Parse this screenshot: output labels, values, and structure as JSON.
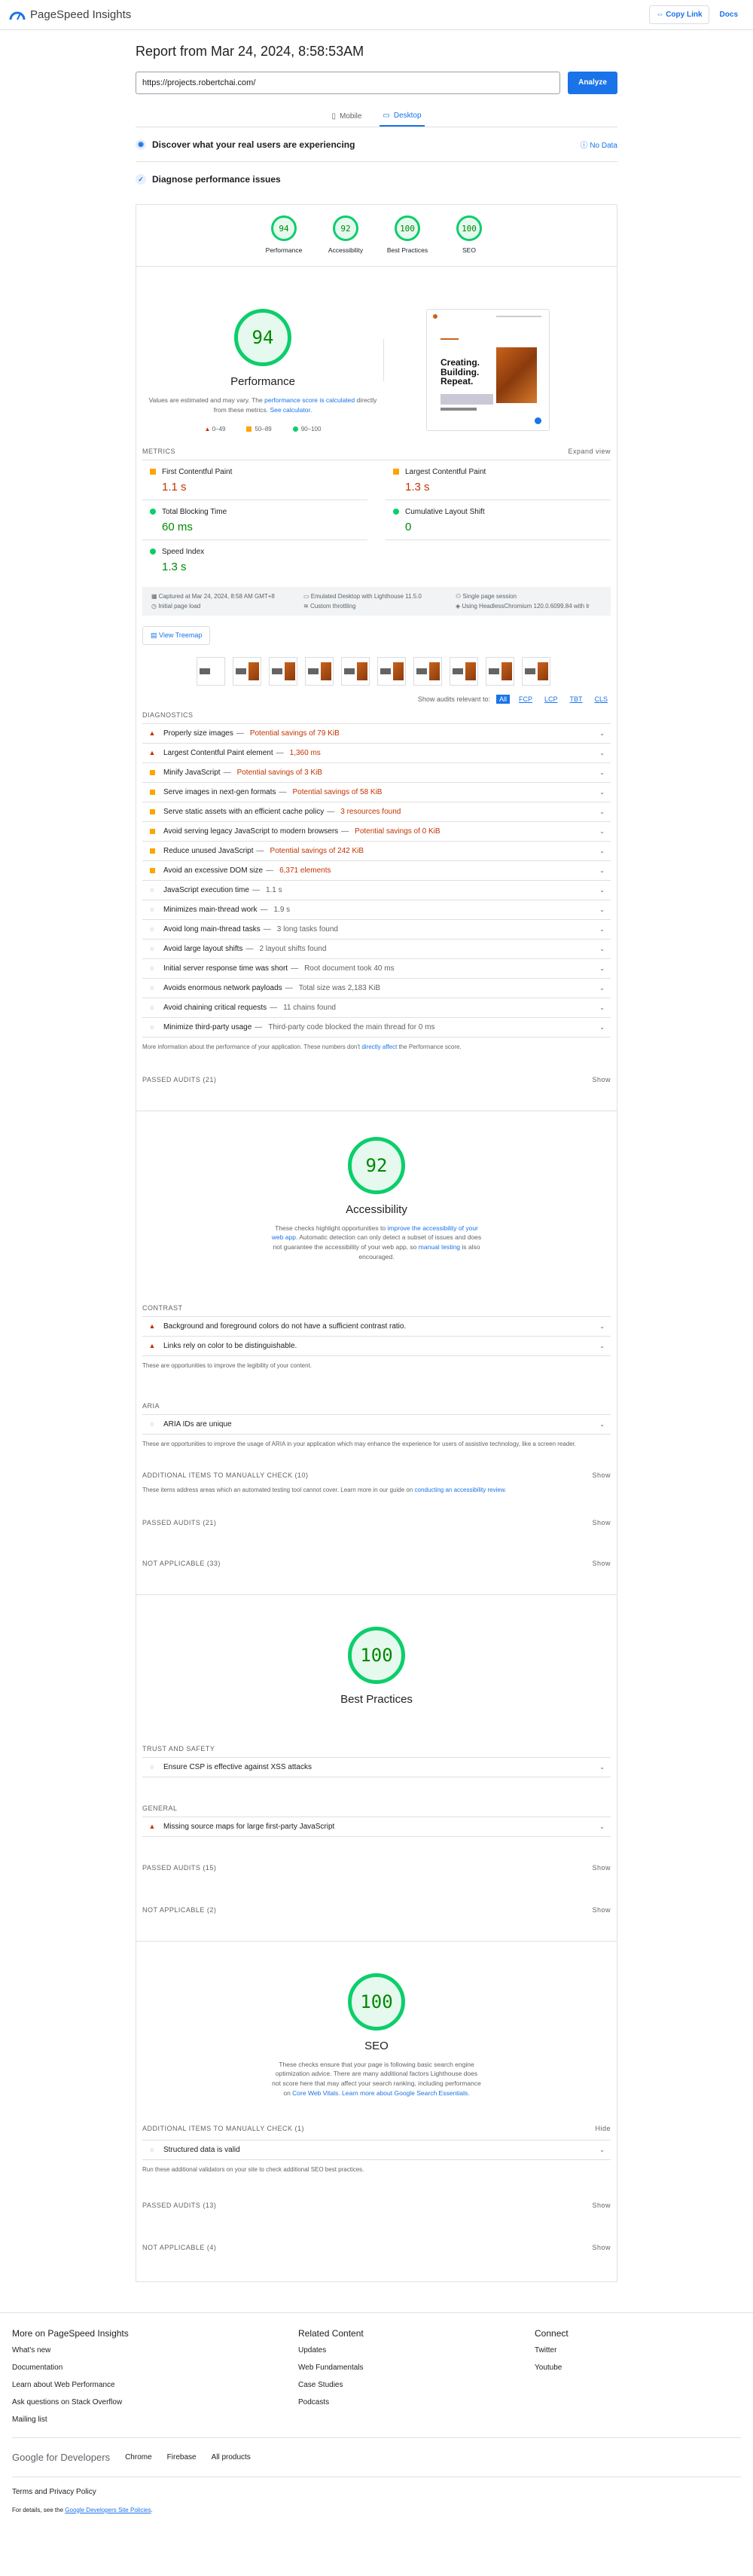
{
  "app": {
    "name": "PageSpeed Insights",
    "copy_link": "Copy Link",
    "docs": "Docs"
  },
  "report": {
    "title": "Report from Mar 24, 2024, 8:58:53AM",
    "url": "https://projects.robertchai.com/",
    "analyze": "Analyze"
  },
  "tabs": {
    "mobile": "Mobile",
    "desktop": "Desktop"
  },
  "crux": {
    "title": "Discover what your real users are experiencing",
    "status": "No Data"
  },
  "diagnose": {
    "title": "Diagnose performance issues"
  },
  "scores": [
    {
      "label": "Performance",
      "value": "94"
    },
    {
      "label": "Accessibility",
      "value": "92"
    },
    {
      "label": "Best Practices",
      "value": "100"
    },
    {
      "label": "SEO",
      "value": "100"
    }
  ],
  "perf": {
    "score": "94",
    "title": "Performance",
    "note_a": "Values are estimated and may vary. The ",
    "note_link": "performance score is calculated",
    "note_b": " directly from these metrics. ",
    "note_link2": "See calculator.",
    "legend": [
      "0–49",
      "50–89",
      "90–100"
    ],
    "shot_headline": [
      "Creating.",
      "Building.",
      "Repeat."
    ]
  },
  "metrics": {
    "label": "METRICS",
    "expand": "Expand view",
    "items": [
      {
        "name": "First Contentful Paint",
        "value": "1.1 s",
        "status": "orange"
      },
      {
        "name": "Largest Contentful Paint",
        "value": "1.3 s",
        "status": "orange"
      },
      {
        "name": "Total Blocking Time",
        "value": "60 ms",
        "status": "green"
      },
      {
        "name": "Cumulative Layout Shift",
        "value": "0",
        "status": "green"
      },
      {
        "name": "Speed Index",
        "value": "1.3 s",
        "status": "green"
      }
    ]
  },
  "env": [
    "Captured at Mar 24, 2024, 8:58 AM GMT+8",
    "Emulated Desktop with Lighthouse 11.5.0",
    "Single page session",
    "Initial page load",
    "Custom throttling",
    "Using HeadlessChromium 120.0.6099.84 with lr"
  ],
  "treemap": "View Treemap",
  "filter": {
    "label": "Show audits relevant to:",
    "chips": [
      "All",
      "FCP",
      "LCP",
      "TBT",
      "CLS"
    ]
  },
  "diagnostics": {
    "label": "DIAGNOSTICS",
    "items": [
      {
        "icon": "red",
        "name": "Properly size images",
        "savings": "Potential savings of 79 KiB",
        "tone": "red"
      },
      {
        "icon": "red",
        "name": "Largest Contentful Paint element",
        "savings": "1,360 ms",
        "tone": "red"
      },
      {
        "icon": "orange",
        "name": "Minify JavaScript",
        "savings": "Potential savings of 3 KiB",
        "tone": "red"
      },
      {
        "icon": "orange",
        "name": "Serve images in next-gen formats",
        "savings": "Potential savings of 58 KiB",
        "tone": "red"
      },
      {
        "icon": "orange",
        "name": "Serve static assets with an efficient cache policy",
        "savings": "3 resources found",
        "tone": "red"
      },
      {
        "icon": "orange",
        "name": "Avoid serving legacy JavaScript to modern browsers",
        "savings": "Potential savings of 0 KiB",
        "tone": "red"
      },
      {
        "icon": "orange",
        "name": "Reduce unused JavaScript",
        "savings": "Potential savings of 242 KiB",
        "tone": "red"
      },
      {
        "icon": "orange",
        "name": "Avoid an excessive DOM size",
        "savings": "6,371 elements",
        "tone": "red"
      },
      {
        "icon": "grey",
        "name": "JavaScript execution time",
        "savings": "1.1 s",
        "tone": "grey"
      },
      {
        "icon": "grey",
        "name": "Minimizes main-thread work",
        "savings": "1.9 s",
        "tone": "grey"
      },
      {
        "icon": "grey",
        "name": "Avoid long main-thread tasks",
        "savings": "3 long tasks found",
        "tone": "grey"
      },
      {
        "icon": "grey",
        "name": "Avoid large layout shifts",
        "savings": "2 layout shifts found",
        "tone": "grey"
      },
      {
        "icon": "grey",
        "name": "Initial server response time was short",
        "savings": "Root document took 40 ms",
        "tone": "grey"
      },
      {
        "icon": "grey",
        "name": "Avoids enormous network payloads",
        "savings": "Total size was 2,183 KiB",
        "tone": "grey"
      },
      {
        "icon": "grey",
        "name": "Avoid chaining critical requests",
        "savings": "11 chains found",
        "tone": "grey"
      },
      {
        "icon": "grey",
        "name": "Minimize third-party usage",
        "savings": "Third-party code blocked the main thread for 0 ms",
        "tone": "grey"
      }
    ],
    "note_a": "More information about the performance of your application. These numbers don't ",
    "note_link": "directly affect",
    "note_b": " the Performance score."
  },
  "passed_perf": {
    "label": "PASSED AUDITS (21)",
    "action": "Show"
  },
  "a11y": {
    "score": "92",
    "title": "Accessibility",
    "desc_a": "These checks highlight opportunities to ",
    "desc_link": "improve the accessibility of your web app",
    "desc_b": ". Automatic detection can only detect a subset of issues and does not guarantee the accessibility of your web app, so ",
    "desc_link2": "manual testing",
    "desc_c": " is also encouraged.",
    "contrast_label": "CONTRAST",
    "contrast_items": [
      "Background and foreground colors do not have a sufficient contrast ratio.",
      "Links rely on color to be distinguishable."
    ],
    "contrast_note": "These are opportunities to improve the legibility of your content.",
    "aria_label": "ARIA",
    "aria_items": [
      "ARIA IDs are unique"
    ],
    "aria_note": "These are opportunities to improve the usage of ARIA in your application which may enhance the experience for users of assistive technology, like a screen reader.",
    "manual_label": "ADDITIONAL ITEMS TO MANUALLY CHECK (10)",
    "manual_note_a": "These items address areas which an automated testing tool cannot cover. Learn more in our guide on ",
    "manual_note_link": "conducting an accessibility review",
    "manual_note_b": ".",
    "passed_label": "PASSED AUDITS (21)",
    "na_label": "NOT APPLICABLE (33)",
    "show": "Show"
  },
  "bp": {
    "score": "100",
    "title": "Best Practices",
    "trust_label": "TRUST AND SAFETY",
    "trust_items": [
      "Ensure CSP is effective against XSS attacks"
    ],
    "general_label": "GENERAL",
    "general_items": [
      "Missing source maps for large first-party JavaScript"
    ],
    "passed_label": "PASSED AUDITS (15)",
    "na_label": "NOT APPLICABLE (2)",
    "show": "Show"
  },
  "seo": {
    "score": "100",
    "title": "SEO",
    "desc_a": "These checks ensure that your page is following basic search engine optimization advice. There are many additional factors Lighthouse does not score here that may affect your search ranking, including performance on ",
    "desc_link": "Core Web Vitals",
    "desc_b": ". ",
    "desc_link2": "Learn more about Google Search Essentials",
    "desc_c": ".",
    "manual_label": "ADDITIONAL ITEMS TO MANUALLY CHECK (1)",
    "hide": "Hide",
    "manual_items": [
      "Structured data is valid"
    ],
    "manual_note": "Run these additional validators on your site to check additional SEO best practices.",
    "passed_label": "PASSED AUDITS (13)",
    "na_label": "NOT APPLICABLE (4)",
    "show": "Show"
  },
  "footer": {
    "col1": {
      "title": "More on PageSpeed Insights",
      "links": [
        "What's new",
        "Documentation",
        "Learn about Web Performance",
        "Ask questions on Stack Overflow",
        "Mailing list"
      ]
    },
    "col2": {
      "title": "Related Content",
      "links": [
        "Updates",
        "Web Fundamentals",
        "Case Studies",
        "Podcasts"
      ]
    },
    "col3": {
      "title": "Connect",
      "links": [
        "Twitter",
        "Youtube"
      ]
    },
    "gdev": "Google for Developers",
    "gdev_links": [
      "Chrome",
      "Firebase",
      "All products"
    ],
    "terms": "Terms and Privacy Policy",
    "fine_a": "For details, see the ",
    "fine_link": "Google Developers Site Policies",
    "fine_b": "."
  },
  "colors": {
    "accent": "#1a73e8",
    "pass": "#0cce6b",
    "average": "#ffa400",
    "fail": "#ff4e42"
  }
}
